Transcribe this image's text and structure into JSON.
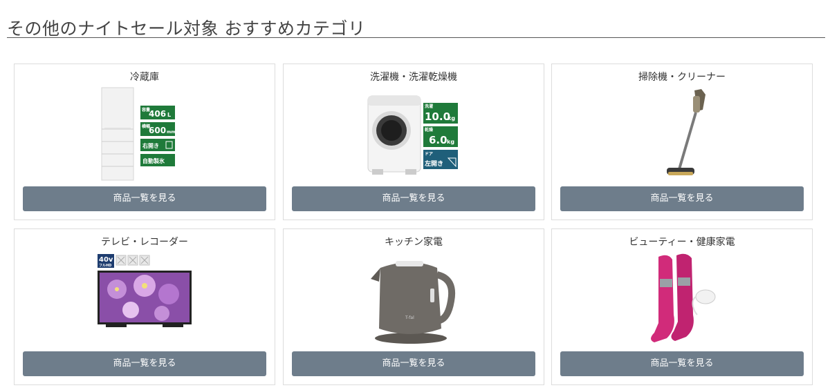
{
  "section": {
    "title": "その他のナイトセール対象 おすすめカテゴリ"
  },
  "categories": [
    {
      "title": "冷蔵庫",
      "button_label": "商品一覧を見る",
      "icon": "refrigerator-image",
      "badges": [
        "容量",
        "406",
        "L",
        "横幅",
        "600",
        "mm",
        "右開き",
        "自動製氷"
      ]
    },
    {
      "title": "洗濯機・洗濯乾燥機",
      "button_label": "商品一覧を見る",
      "icon": "washing-machine-image",
      "badges": [
        "洗濯",
        "10.0",
        "kg",
        "乾燥",
        "6.0",
        "kg",
        "ドア",
        "左開き"
      ]
    },
    {
      "title": "掃除機・クリーナー",
      "button_label": "商品一覧を見る",
      "icon": "stick-vacuum-image"
    },
    {
      "title": "テレビ・レコーダー",
      "button_label": "商品一覧を見る",
      "icon": "television-image",
      "badges": [
        "40v",
        "フルHD"
      ]
    },
    {
      "title": "キッチン家電",
      "button_label": "商品一覧を見る",
      "icon": "electric-kettle-image",
      "brand": "T-fal"
    },
    {
      "title": "ビューティー・健康家電",
      "button_label": "商品一覧を見る",
      "icon": "leg-massager-image"
    }
  ],
  "colors": {
    "button_bg": "#6e7d8b",
    "button_text": "#ffffff",
    "badge_green": "#1f7a3a",
    "card_border": "#dcdcdc",
    "massager_pink": "#d12b7a",
    "kettle_gray": "#6f6b66"
  }
}
